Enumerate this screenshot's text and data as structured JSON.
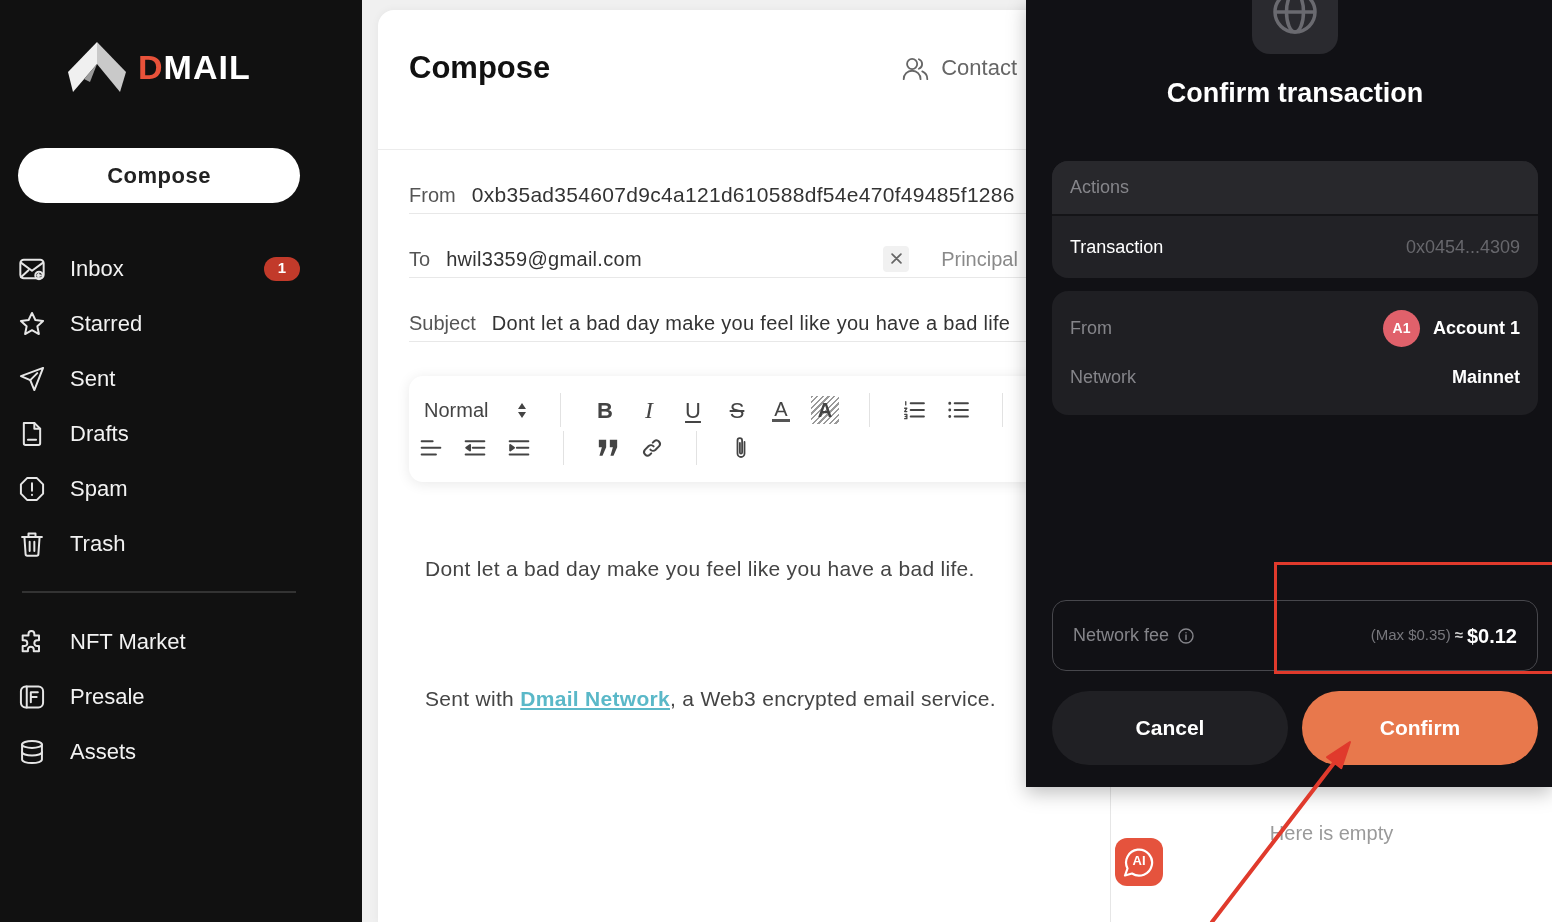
{
  "sidebar": {
    "logo": "DMAIL",
    "compose_button": "Compose",
    "sections": [
      {
        "items": [
          {
            "label": "Inbox",
            "badge": "1"
          },
          {
            "label": "Starred"
          },
          {
            "label": "Sent"
          },
          {
            "label": "Drafts"
          },
          {
            "label": "Spam"
          },
          {
            "label": "Trash"
          }
        ]
      },
      {
        "items": [
          {
            "label": "NFT Market"
          },
          {
            "label": "Presale"
          },
          {
            "label": "Assets"
          }
        ]
      }
    ]
  },
  "compose": {
    "title": "Compose",
    "contact_button": "Contact",
    "fields": [
      {
        "kind": "from",
        "label": "From",
        "value": "0xb35ad354607d9c4a121d610588df54e470f49485f1286"
      },
      {
        "kind": "recipient",
        "label": "To",
        "value": "hwil3359@gmail.com",
        "recipient_type": "Principal"
      },
      {
        "kind": "subject",
        "label": "Subject",
        "value": "Dont let a bad day make you feel like you have a bad life"
      }
    ],
    "toolbar": {
      "rows": [
        {
          "groups": [
            {
              "buttons": [
                {
                  "kind": "heading",
                  "label": "Normal"
                }
              ]
            },
            {
              "buttons": [
                {
                  "kind": "bold",
                  "label": "B"
                },
                {
                  "kind": "italic",
                  "label": "I"
                },
                {
                  "kind": "underline",
                  "label": "U"
                },
                {
                  "kind": "strike",
                  "label": "S"
                },
                {
                  "kind": "color",
                  "label": "A"
                },
                {
                  "kind": "background",
                  "label": "A"
                }
              ]
            },
            {
              "buttons": [
                {
                  "kind": "ordered_list"
                },
                {
                  "kind": "bullet_list"
                }
              ]
            }
          ]
        },
        {
          "groups": [
            {
              "buttons": [
                {
                  "kind": "align"
                },
                {
                  "kind": "outdent"
                },
                {
                  "kind": "indent"
                }
              ]
            },
            {
              "buttons": [
                {
                  "kind": "blockquote"
                },
                {
                  "kind": "link"
                }
              ]
            },
            {
              "buttons": [
                {
                  "kind": "attach"
                }
              ]
            }
          ]
        }
      ]
    },
    "editor": {
      "body": "Dont let a bad day make you feel like you have a bad life.",
      "signature": {
        "before": "Sent with ",
        "link": "Dmail Network",
        "after": ", a Web3 encrypted email service."
      }
    }
  },
  "contacts_panel": {
    "empty_text": "Here is empty"
  },
  "ai_button": {
    "label": "AI"
  },
  "wallet": {
    "title": "Confirm transaction",
    "actions": {
      "heading": "Actions",
      "rows": [
        {
          "label": "Transaction",
          "value": "0x0454...4309"
        }
      ]
    },
    "details": [
      {
        "label": "From",
        "avatar": "A1",
        "value": "Account 1"
      },
      {
        "label": "Network",
        "value": "Mainnet"
      }
    ],
    "fee": {
      "label": "Network fee",
      "max": "(Max $0.35)",
      "approx": "≈",
      "value": "$0.12"
    },
    "buttons": [
      {
        "kind": "secondary",
        "label": "Cancel"
      },
      {
        "kind": "primary",
        "label": "Confirm"
      }
    ]
  }
}
